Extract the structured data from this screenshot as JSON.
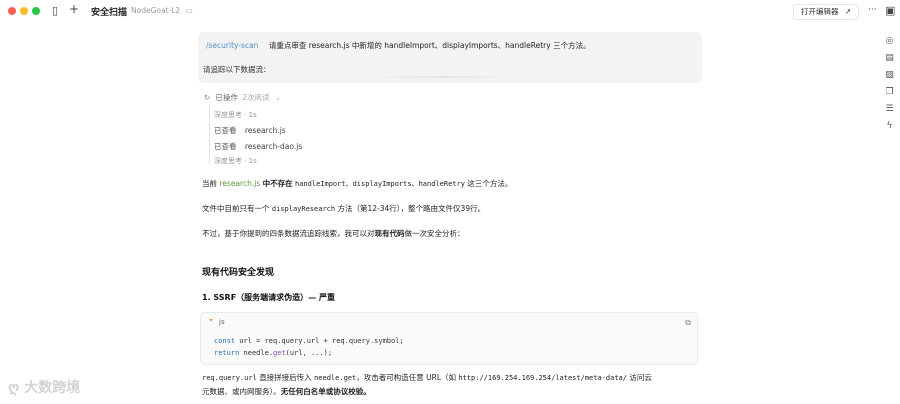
{
  "window": {
    "title": "安全扫描",
    "subtitle": "NodeGoat-L2",
    "open_editor": "打开编辑器",
    "open_editor_icon": "↗",
    "more": "···"
  },
  "colors": {
    "close": "#ff5f57",
    "minimize": "#febc2e",
    "maximize": "#28c840",
    "link": "#4f8fc9",
    "green": "#5b9b3a"
  },
  "message": {
    "command": "/security-scan",
    "text": "请重点审查 research.js 中新增的 handleImport、displayImports、handleRetry 三个方法。",
    "line2": "请追踪以下数据流："
  },
  "operations": {
    "label": "已操作",
    "count": "2次阅读",
    "items": [
      {
        "type": "thought",
        "text": "深度思考 · 1s"
      },
      {
        "type": "view",
        "action": "已查看",
        "file": "research.js"
      },
      {
        "type": "view",
        "action": "已查看",
        "file": "research-dao.js"
      },
      {
        "type": "thought",
        "text": "深度思考 · 1s"
      }
    ]
  },
  "response": {
    "p1_prefix": "当前",
    "p1_file": "research.js",
    "p1_notexist": "中不存在",
    "p1_methods": "handleImport、displayImports、handleRetry",
    "p1_suffix": "这三个方法。",
    "p2_prefix": "文件中目前只有一个",
    "p2_method": "displayResearch",
    "p2_suffix": "方法（第12-34行），整个路由文件仅39行。",
    "p3_prefix": "不过，基于你提到的四条数据流追踪线索，我可以对",
    "p3_bold": "现有代码",
    "p3_suffix": "做一次安全分析：",
    "h2": "现有代码安全发现",
    "h3": "1. SSRF（服务端请求伪造）— 严重",
    "code_lang": "js",
    "code_lines": [
      "const url = req.query.url + req.query.symbol;",
      "return needle.get(url, ...);"
    ],
    "p4_code1": "req.query.url",
    "p4_text1": "直接拼接后传入",
    "p4_code2": "needle.get",
    "p4_text2": "，攻击者可构造任意 URL（如",
    "p4_code3": "http://169.254.169.254/latest/meta-data/",
    "p4_text3": "访问云",
    "p5_text": "元数据、或内网服务）。",
    "p5_bold": "无任何白名单或协议校验。"
  },
  "watermark": "大数跨境"
}
